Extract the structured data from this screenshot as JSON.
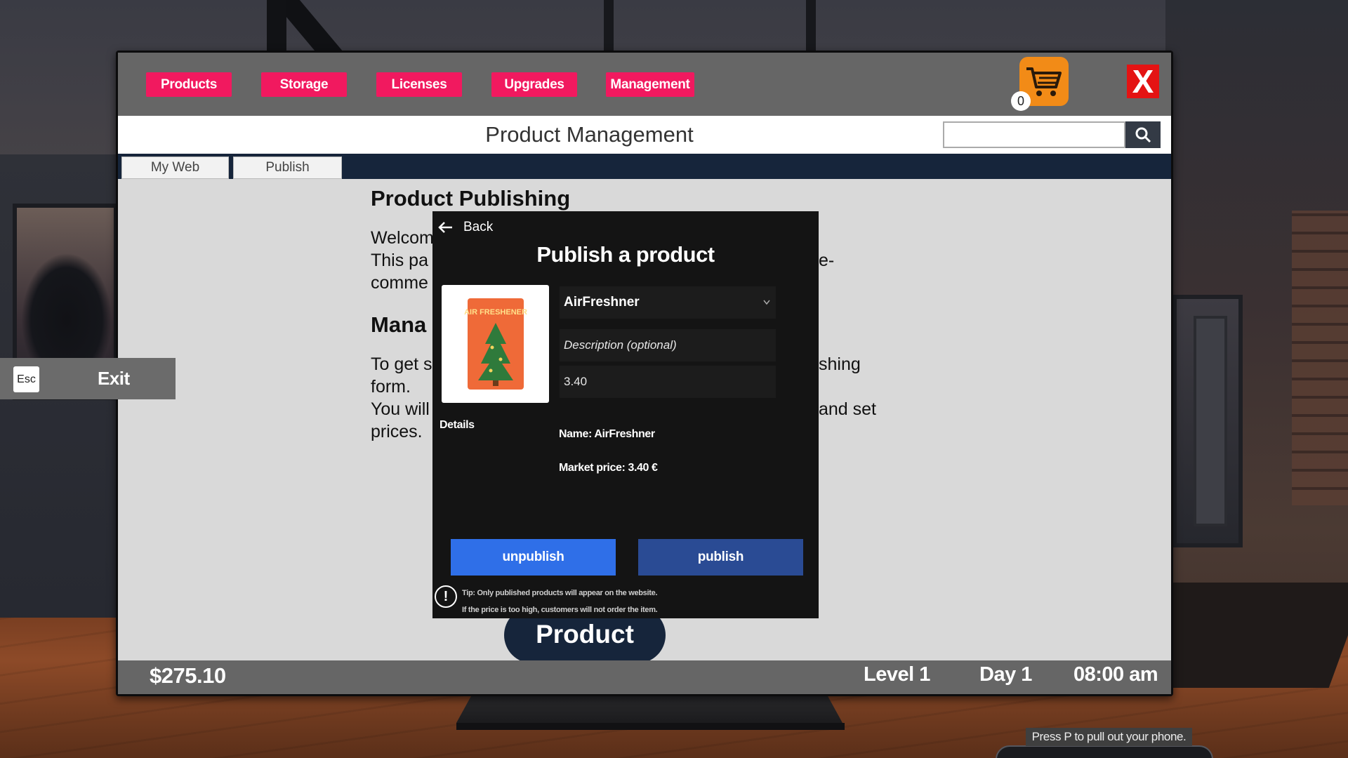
{
  "nav": {
    "products": "Products",
    "storage": "Storage",
    "licenses": "Licenses",
    "upgrades": "Upgrades",
    "management": "Management"
  },
  "cart": {
    "count": "0"
  },
  "close_label": "X",
  "header": {
    "title": "Product Management",
    "search_placeholder": ""
  },
  "subnav": {
    "tab1": "My Web",
    "tab2": "Publish"
  },
  "content": {
    "heading": "Product Publishing",
    "line1": "Welcom",
    "line2_a": "This pa",
    "line2_b": "e-",
    "line3": "comme",
    "subheading": "Mana",
    "line4_a": "To get s",
    "line4_b": "shing",
    "line5": "form.",
    "line6_a": "You will",
    "line6_b": "and set",
    "line7": "prices."
  },
  "background_button": "Product",
  "modal": {
    "back_label": "Back",
    "title": "Publish a product",
    "product_select": "AirFreshner",
    "description_placeholder": "Description (optional)",
    "price_value": "3.40",
    "details_label": "Details",
    "name_info": "Name: AirFreshner",
    "market_price_info": "Market price: 3.40 €",
    "unpublish_label": "unpublish",
    "publish_label": "publish",
    "tip_line1": "Tip: Only published products will appear on the website.",
    "tip_line2": "If the price is too high, customers will not order the item.",
    "product_image_text": "AIR FRESHENER"
  },
  "status": {
    "money": "$275.10",
    "level": "Level 1",
    "day": "Day 1",
    "time": "08:00 am"
  },
  "esc": {
    "key": "Esc",
    "label": "Exit"
  },
  "hint": "Press P to pull out your phone.",
  "colors": {
    "nav_pink": "#f1195f",
    "cart_orange": "#f28b17",
    "close_red": "#e41313",
    "navy": "#16253b",
    "unpublish_blue": "#2f6fe8",
    "publish_blue": "#2a4b94"
  }
}
